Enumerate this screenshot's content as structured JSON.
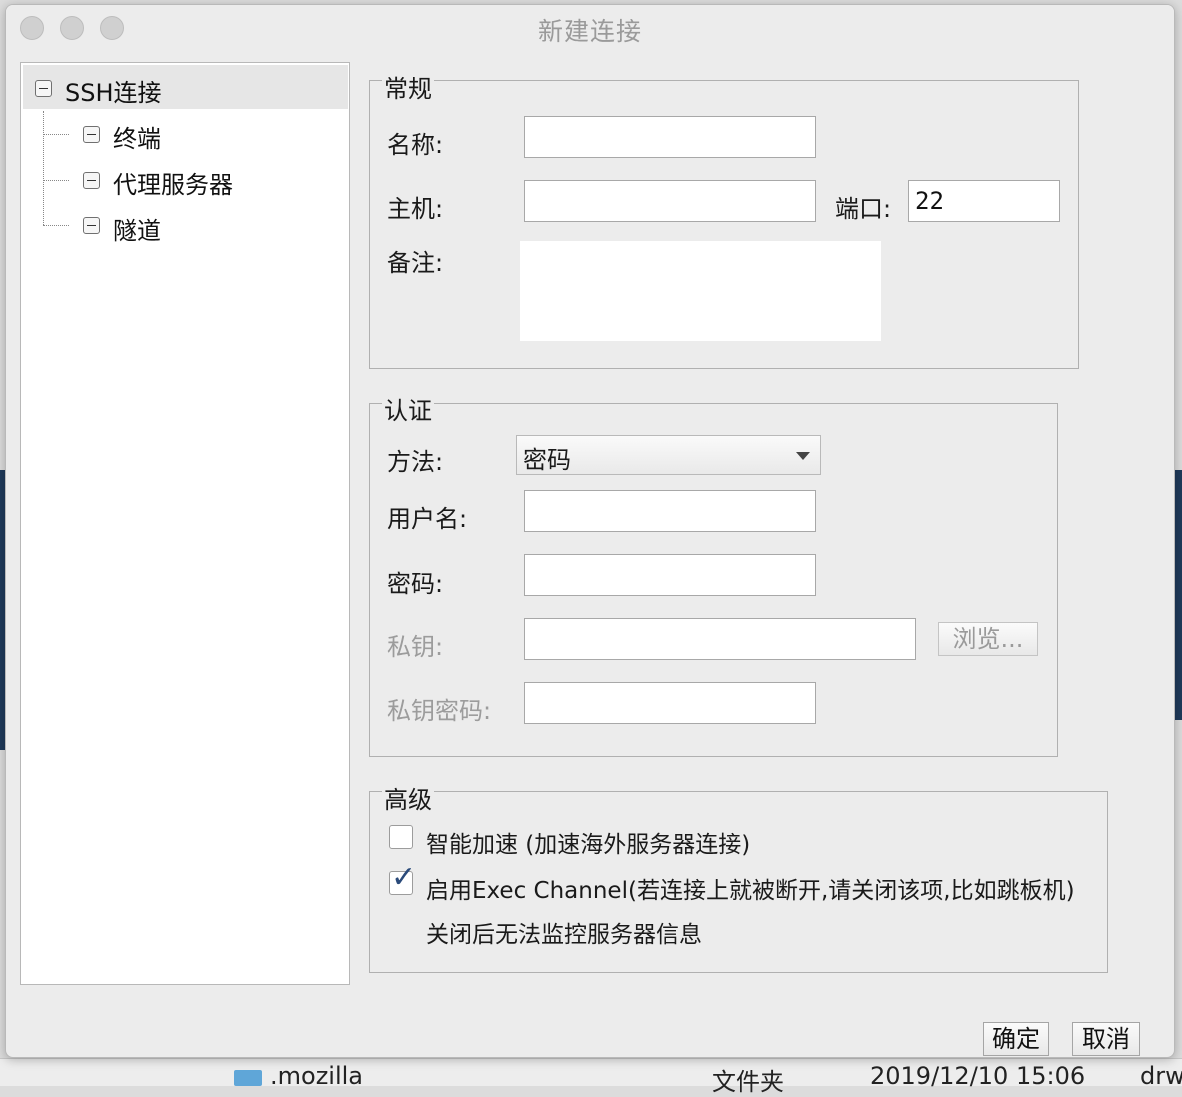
{
  "background": {
    "folder_name": ".mozilla",
    "folder_type": "文件夹",
    "date": "2019/12/10 15:06",
    "perm": "drw"
  },
  "dialog": {
    "title": "新建连接",
    "tree": {
      "root": "SSH连接",
      "children": [
        "终端",
        "代理服务器",
        "隧道"
      ]
    },
    "general": {
      "title": "常规",
      "name_label": "名称:",
      "name_value": "",
      "host_label": "主机:",
      "host_value": "",
      "port_label": "端口:",
      "port_value": "22",
      "note_label": "备注:",
      "note_value": ""
    },
    "auth": {
      "title": "认证",
      "method_label": "方法:",
      "method_value": "密码",
      "username_label": "用户名:",
      "username_value": "",
      "password_label": "密码:",
      "password_value": "",
      "key_label": "私钥:",
      "key_value": "",
      "browse_label": "浏览...",
      "key_pass_label": "私钥密码:",
      "key_pass_value": ""
    },
    "advanced": {
      "title": "高级",
      "smart_accel_label": "智能加速 (加速海外服务器连接)",
      "smart_accel_checked": false,
      "exec_channel_label": "启用Exec Channel(若连接上就被断开,请关闭该项,比如跳板机)",
      "exec_channel_checked": true,
      "exec_channel_note": "关闭后无法监控服务器信息"
    },
    "ok_label": "确定",
    "cancel_label": "取消"
  },
  "colors": {
    "window_bg": "#ececec",
    "check_mark": "#2a4a7a",
    "disabled_text": "#9c9c9c"
  }
}
